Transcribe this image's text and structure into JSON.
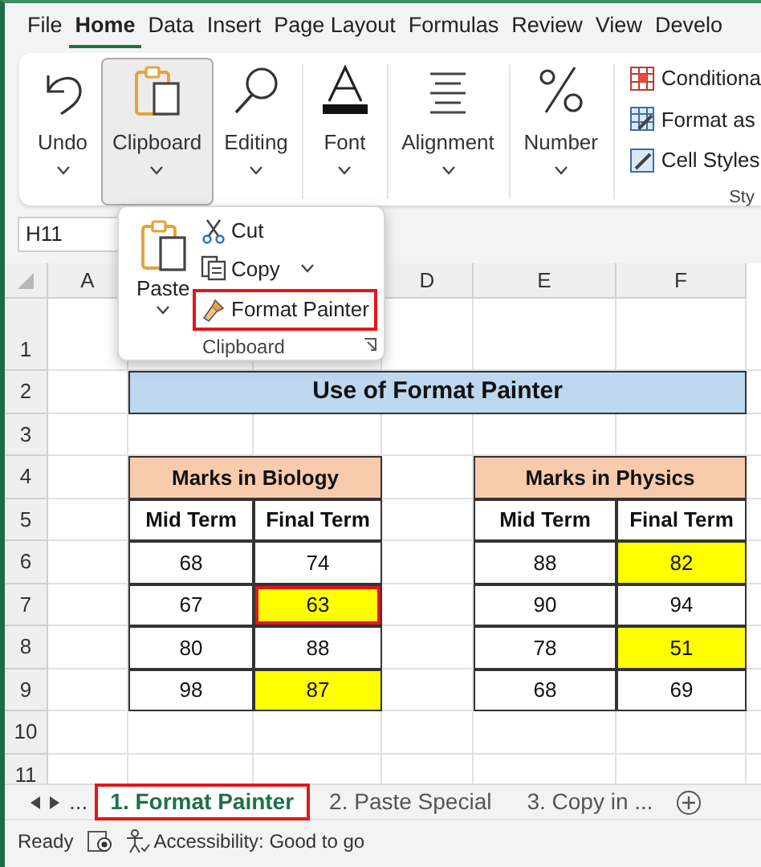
{
  "menu_tabs": [
    {
      "label": "File",
      "selected": false
    },
    {
      "label": "Home",
      "selected": true
    },
    {
      "label": "Data",
      "selected": false
    },
    {
      "label": "Insert",
      "selected": false
    },
    {
      "label": "Page Layout",
      "selected": false
    },
    {
      "label": "Formulas",
      "selected": false
    },
    {
      "label": "Review",
      "selected": false
    },
    {
      "label": "View",
      "selected": false
    },
    {
      "label": "Develo",
      "selected": false
    }
  ],
  "ribbon_groups": [
    {
      "kind": "undo",
      "label": "Undo",
      "pressed": false
    },
    {
      "kind": "clipboard",
      "label": "Clipboard",
      "pressed": true
    },
    {
      "kind": "editing",
      "label": "Editing",
      "pressed": false
    },
    {
      "kind": "font",
      "label": "Font",
      "pressed": false
    },
    {
      "kind": "alignment",
      "label": "Alignment",
      "pressed": false
    },
    {
      "kind": "number",
      "label": "Number",
      "pressed": false
    }
  ],
  "styles_group": {
    "items": [
      {
        "kind": "conditional",
        "label": "Conditiona"
      },
      {
        "kind": "table",
        "label": "Format as"
      },
      {
        "kind": "cell",
        "label": "Cell Styles"
      }
    ],
    "label": "Sty"
  },
  "clipboard_menu": {
    "paste": "Paste",
    "items": [
      {
        "kind": "cut",
        "label": "Cut",
        "caret": false,
        "outlined": false
      },
      {
        "kind": "copy",
        "label": "Copy",
        "caret": true,
        "outlined": false
      },
      {
        "kind": "painter",
        "label": "Format Painter",
        "caret": false,
        "outlined": true
      }
    ],
    "label": "Clipboard"
  },
  "name_box": "H11",
  "column_headers": [
    "A",
    "D",
    "E",
    "F"
  ],
  "row_numbers": [
    "1",
    "2",
    "3",
    "4",
    "5",
    "6",
    "7",
    "8",
    "9",
    "10",
    "11"
  ],
  "title": "Use of Format Painter",
  "tables": [
    {
      "title": "Marks in Biology",
      "headers": [
        "Mid Term",
        "Final Term"
      ],
      "rows": [
        [
          {
            "text": "68",
            "highlighted": false,
            "outlined": false
          },
          {
            "text": "74",
            "highlighted": false,
            "outlined": false
          }
        ],
        [
          {
            "text": "67",
            "highlighted": false,
            "outlined": false
          },
          {
            "text": "63",
            "highlighted": true,
            "outlined": true
          }
        ],
        [
          {
            "text": "80",
            "highlighted": false,
            "outlined": false
          },
          {
            "text": "88",
            "highlighted": false,
            "outlined": false
          }
        ],
        [
          {
            "text": "98",
            "highlighted": false,
            "outlined": false
          },
          {
            "text": "87",
            "highlighted": true,
            "outlined": false
          }
        ]
      ]
    },
    {
      "title": "Marks in Physics",
      "headers": [
        "Mid Term",
        "Final Term"
      ],
      "rows": [
        [
          {
            "text": "88",
            "highlighted": false,
            "outlined": false
          },
          {
            "text": "82",
            "highlighted": true,
            "outlined": false
          }
        ],
        [
          {
            "text": "90",
            "highlighted": false,
            "outlined": false
          },
          {
            "text": "94",
            "highlighted": false,
            "outlined": false
          }
        ],
        [
          {
            "text": "78",
            "highlighted": false,
            "outlined": false
          },
          {
            "text": "51",
            "highlighted": true,
            "outlined": false
          }
        ],
        [
          {
            "text": "68",
            "highlighted": false,
            "outlined": false
          },
          {
            "text": "69",
            "highlighted": false,
            "outlined": false
          }
        ]
      ]
    }
  ],
  "sheet_more": "...",
  "sheet_tabs": [
    {
      "label": "1. Format Painter",
      "selected": true,
      "outlined": true
    },
    {
      "label": "2. Paste Special",
      "selected": false,
      "outlined": false
    },
    {
      "label": "3. Copy in ...",
      "selected": false,
      "outlined": false
    }
  ],
  "status_bar": {
    "ready": "Ready",
    "accessibility": "Accessibility: Good to go"
  }
}
